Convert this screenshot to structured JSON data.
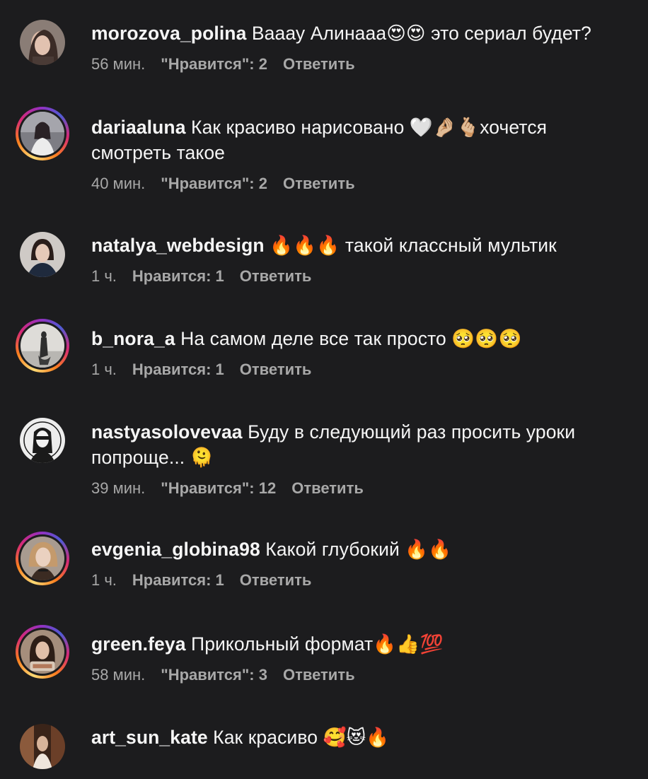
{
  "comments": [
    {
      "username": "morozova_polina",
      "text": "Вааау Алинааа😍😍 это сериал будет?",
      "time": "56 мин.",
      "likes": "\"Нравится\": 2",
      "reply": "Ответить",
      "story_ring": false,
      "avatar_colors": [
        "#8a7d76",
        "#4a3b36"
      ]
    },
    {
      "username": "dariaaluna",
      "text": "Как красиво нарисовано 🤍🤌🏼🫰🏼хочется смотреть такое",
      "time": "40 мин.",
      "likes": "\"Нравится\": 2",
      "reply": "Ответить",
      "story_ring": true,
      "avatar_colors": [
        "#9a9aa0",
        "#2a2a30"
      ]
    },
    {
      "username": "natalya_webdesign",
      "text": "🔥🔥🔥 такой классный мультик",
      "time": "1 ч.",
      "likes": "Нравится: 1",
      "reply": "Ответить",
      "story_ring": false,
      "avatar_colors": [
        "#c9c4bf",
        "#2a1d1a"
      ]
    },
    {
      "username": "b_nora_a",
      "text": "На самом деле все так просто 🥺🥺🥺",
      "time": "1 ч.",
      "likes": "Нравится: 1",
      "reply": "Ответить",
      "story_ring": true,
      "avatar_colors": [
        "#d8d6d2",
        "#3a3a3a"
      ]
    },
    {
      "username": "nastyasolovevaa",
      "text": "Буду в следующий раз просить уроки попроще... 🫠",
      "time": "39 мин.",
      "likes": "\"Нравится\": 12",
      "reply": "Ответить",
      "story_ring": false,
      "avatar_colors": [
        "#e8e8e8",
        "#1a1a1a"
      ]
    },
    {
      "username": "evgenia_globina98",
      "text": "Какой глубокий 🔥🔥",
      "time": "1 ч.",
      "likes": "Нравится: 1",
      "reply": "Ответить",
      "story_ring": true,
      "avatar_colors": [
        "#b8a89a",
        "#3b2b22"
      ]
    },
    {
      "username": "green.feya",
      "text": "Прикольный формат🔥👍💯",
      "time": "58 мин.",
      "likes": "\"Нравится\": 3",
      "reply": "Ответить",
      "story_ring": true,
      "avatar_colors": [
        "#b79b86",
        "#2d1e17"
      ]
    },
    {
      "username": "art_sun_kate",
      "text": "Как красиво 🥰😻🔥",
      "time": "",
      "likes": "",
      "reply": "",
      "story_ring": false,
      "avatar_colors": [
        "#8b5a3c",
        "#1e1410"
      ]
    }
  ]
}
